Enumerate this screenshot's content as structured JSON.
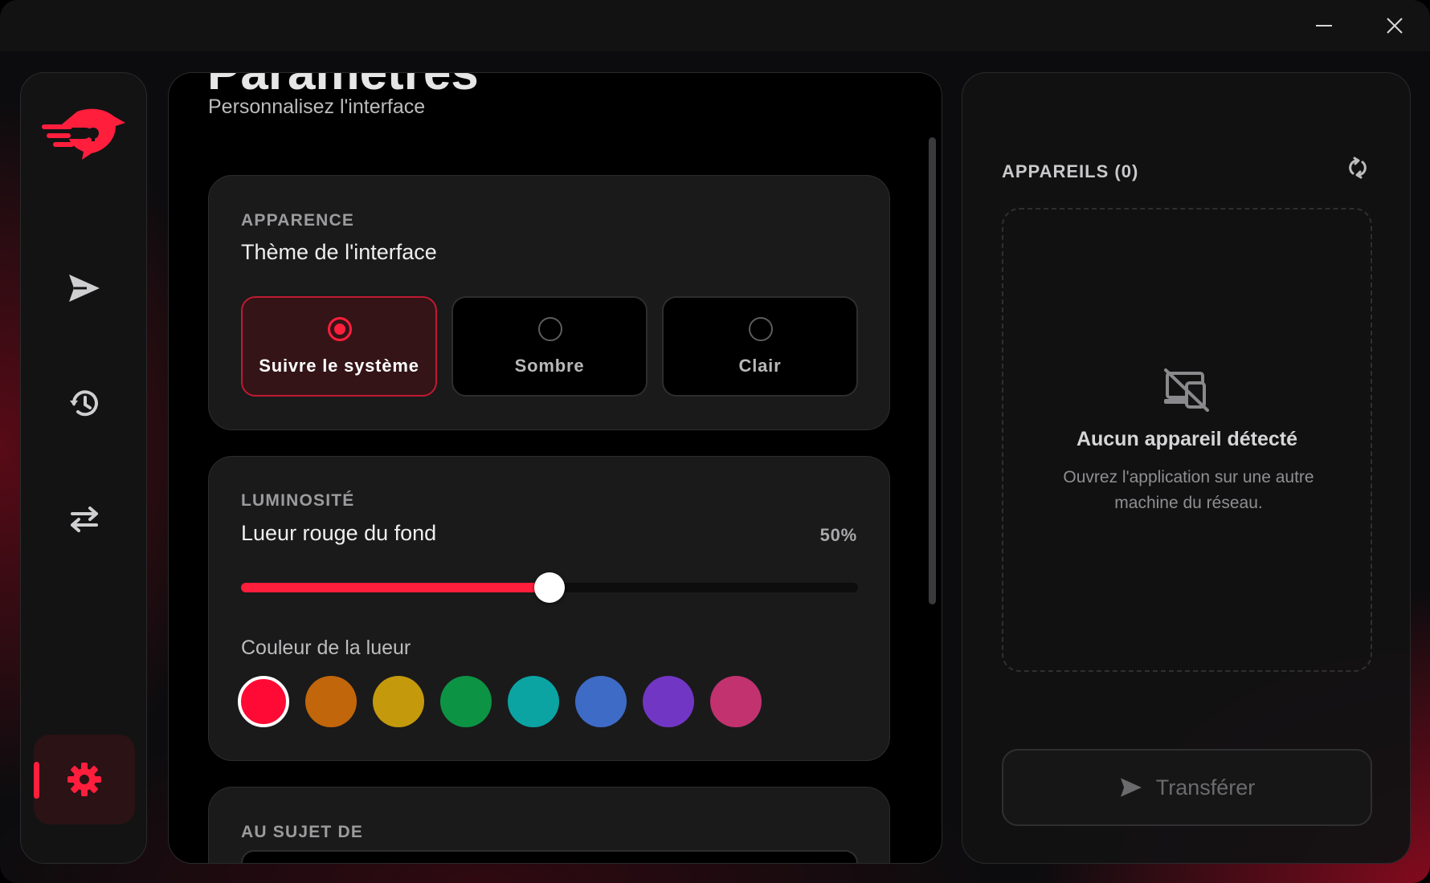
{
  "window": {
    "controls": {
      "minimize_icon": "minimize-icon",
      "close_icon": "close-icon"
    }
  },
  "sidebar": {
    "logo": "eagle-logo",
    "items": [
      {
        "id": "send",
        "icon": "send-icon",
        "active": false
      },
      {
        "id": "history",
        "icon": "history-icon",
        "active": false
      },
      {
        "id": "transfer",
        "icon": "swap-arrows-icon",
        "active": false
      },
      {
        "id": "settings",
        "icon": "gear-icon",
        "active": true
      }
    ]
  },
  "main": {
    "title": "Paramètres",
    "subtitle": "Personnalisez l'interface",
    "appearance": {
      "section_label": "APPARENCE",
      "heading": "Thème de l'interface",
      "options": [
        {
          "label": "Suivre le système",
          "selected": true
        },
        {
          "label": "Sombre",
          "selected": false
        },
        {
          "label": "Clair",
          "selected": false
        }
      ]
    },
    "luminosity": {
      "section_label": "LUMINOSITÉ",
      "heading": "Lueur rouge du fond",
      "value_label": "50%",
      "value": 0.5,
      "color_heading": "Couleur de la lueur",
      "colors": [
        "#ff0a34",
        "#c1660a",
        "#c4990c",
        "#0c9444",
        "#0ca3a3",
        "#3d6bc6",
        "#7236c4",
        "#c2326f"
      ],
      "selected_color_index": 0
    },
    "about": {
      "section_label": "AU SUJET DE"
    }
  },
  "devices": {
    "title": "APPAREILS (0)",
    "refresh_icon": "refresh-icon",
    "empty_icon": "device-off-icon",
    "empty_title": "Aucun appareil détecté",
    "empty_desc": "Ouvrez l'application sur une autre machine du réseau.",
    "transfer_label": "Transférer",
    "transfer_icon": "send-icon"
  },
  "theme": {
    "accent": "#ff1e3c"
  }
}
